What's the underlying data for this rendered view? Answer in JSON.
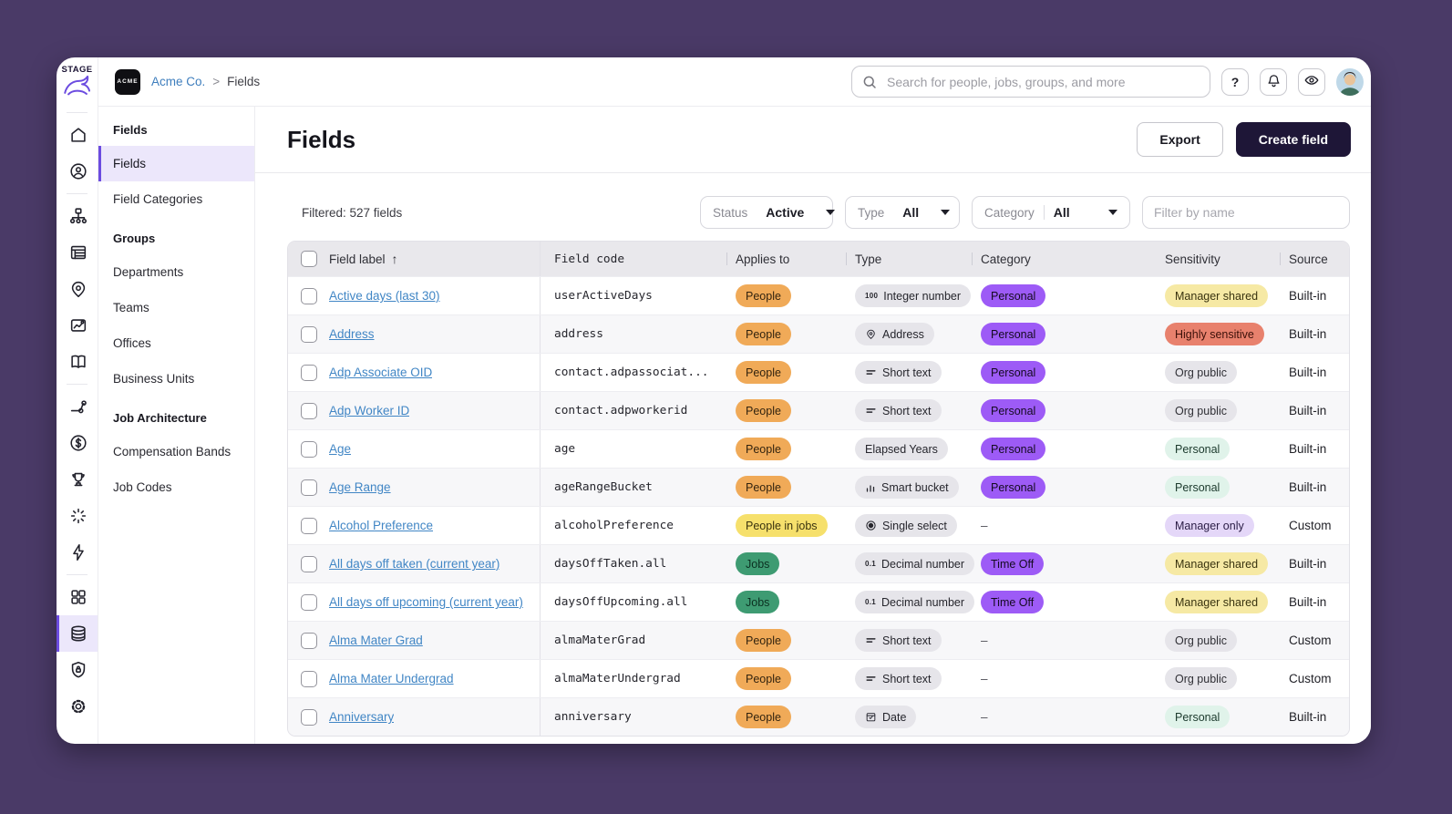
{
  "chrome": {
    "env": "STAGE"
  },
  "topbar": {
    "org_logo": "ACME",
    "breadcrumb": {
      "org": "Acme Co.",
      "separator": ">",
      "page": "Fields"
    },
    "search_placeholder": "Search for people, jobs, groups, and more",
    "help_label": "?"
  },
  "rail": {
    "items": [
      {
        "id": "home"
      },
      {
        "id": "people"
      },
      {
        "id": "org-chart"
      },
      {
        "id": "documents"
      },
      {
        "id": "locations"
      },
      {
        "id": "reports"
      },
      {
        "id": "library"
      },
      {
        "id": "workflows"
      },
      {
        "id": "payroll"
      },
      {
        "id": "performance"
      },
      {
        "id": "spark"
      },
      {
        "id": "automations"
      },
      {
        "id": "apps"
      },
      {
        "id": "data",
        "active": true
      },
      {
        "id": "security"
      },
      {
        "id": "settings"
      }
    ]
  },
  "sidenav": {
    "sections": [
      {
        "header": "Fields",
        "items": [
          {
            "label": "Fields",
            "active": true
          },
          {
            "label": "Field Categories"
          }
        ]
      },
      {
        "header": "Groups",
        "items": [
          {
            "label": "Departments"
          },
          {
            "label": "Teams"
          },
          {
            "label": "Offices"
          },
          {
            "label": "Business Units"
          }
        ]
      },
      {
        "header": "Job Architecture",
        "items": [
          {
            "label": "Compensation Bands"
          },
          {
            "label": "Job Codes"
          }
        ]
      }
    ]
  },
  "page": {
    "title": "Fields",
    "export_label": "Export",
    "create_label": "Create field",
    "filtered": "Filtered: 527 fields",
    "name_filter_placeholder": "Filter by name",
    "filters": [
      {
        "id": "status",
        "label": "Status",
        "value": "Active"
      },
      {
        "id": "type",
        "label": "Type",
        "value": "All"
      },
      {
        "id": "category",
        "label": "Category",
        "value": "All"
      }
    ]
  },
  "table": {
    "sort_indicator": "↑",
    "empty": "–",
    "columns": [
      "Field label",
      "Field code",
      "Applies to",
      "Type",
      "Category",
      "Sensitivity",
      "Source"
    ],
    "rows": [
      {
        "label": "Active days (last 30)",
        "code": "userActiveDays",
        "applies": {
          "text": "People",
          "tone": "people"
        },
        "type": {
          "icon": "integer-number-icon",
          "text": "Integer number"
        },
        "category": "Personal",
        "sensitivity": {
          "text": "Manager shared",
          "tone": "yellow"
        },
        "source": "Built-in"
      },
      {
        "label": "Address",
        "code": "address",
        "applies": {
          "text": "People",
          "tone": "people"
        },
        "type": {
          "icon": "address-icon",
          "text": "Address"
        },
        "category": "Personal",
        "sensitivity": {
          "text": "Highly sensitive",
          "tone": "red"
        },
        "source": "Built-in"
      },
      {
        "label": "Adp Associate OID",
        "code": "contact.adpassociat...",
        "applies": {
          "text": "People",
          "tone": "people"
        },
        "type": {
          "icon": "short-text-icon",
          "text": "Short text"
        },
        "category": "Personal",
        "sensitivity": {
          "text": "Org public",
          "tone": "gray"
        },
        "source": "Built-in"
      },
      {
        "label": "Adp Worker ID",
        "code": "contact.adpworkerid",
        "applies": {
          "text": "People",
          "tone": "people"
        },
        "type": {
          "icon": "short-text-icon",
          "text": "Short text"
        },
        "category": "Personal",
        "sensitivity": {
          "text": "Org public",
          "tone": "gray"
        },
        "source": "Built-in"
      },
      {
        "label": "Age",
        "code": "age",
        "applies": {
          "text": "People",
          "tone": "people"
        },
        "type": {
          "icon": null,
          "text": "Elapsed Years"
        },
        "category": "Personal",
        "sensitivity": {
          "text": "Personal",
          "tone": "mint"
        },
        "source": "Built-in"
      },
      {
        "label": "Age Range",
        "code": "ageRangeBucket",
        "applies": {
          "text": "People",
          "tone": "people"
        },
        "type": {
          "icon": "smart-bucket-icon",
          "text": "Smart bucket"
        },
        "category": "Personal",
        "sensitivity": {
          "text": "Personal",
          "tone": "mint"
        },
        "source": "Built-in"
      },
      {
        "label": "Alcohol Preference",
        "code": "alcoholPreference",
        "applies": {
          "text": "People in jobs",
          "tone": "people-in-jobs"
        },
        "type": {
          "icon": "single-select-icon",
          "text": "Single select"
        },
        "category": null,
        "sensitivity": {
          "text": "Manager only",
          "tone": "lavender"
        },
        "source": "Custom"
      },
      {
        "label": "All days off taken (current year)",
        "code": "daysOffTaken.all",
        "applies": {
          "text": "Jobs",
          "tone": "jobs"
        },
        "type": {
          "icon": "decimal-number-icon",
          "text": "Decimal number"
        },
        "category": "Time Off",
        "sensitivity": {
          "text": "Manager shared",
          "tone": "yellow"
        },
        "source": "Built-in"
      },
      {
        "label": "All days off upcoming (current year)",
        "code": "daysOffUpcoming.all",
        "applies": {
          "text": "Jobs",
          "tone": "jobs"
        },
        "type": {
          "icon": "decimal-number-icon",
          "text": "Decimal number"
        },
        "category": "Time Off",
        "sensitivity": {
          "text": "Manager shared",
          "tone": "yellow"
        },
        "source": "Built-in"
      },
      {
        "label": "Alma Mater Grad",
        "code": "almaMaterGrad",
        "applies": {
          "text": "People",
          "tone": "people"
        },
        "type": {
          "icon": "short-text-icon",
          "text": "Short text"
        },
        "category": null,
        "sensitivity": {
          "text": "Org public",
          "tone": "gray"
        },
        "source": "Custom"
      },
      {
        "label": "Alma Mater Undergrad",
        "code": "almaMaterUndergrad",
        "applies": {
          "text": "People",
          "tone": "people"
        },
        "type": {
          "icon": "short-text-icon",
          "text": "Short text"
        },
        "category": null,
        "sensitivity": {
          "text": "Org public",
          "tone": "gray"
        },
        "source": "Custom"
      },
      {
        "label": "Anniversary",
        "code": "anniversary",
        "applies": {
          "text": "People",
          "tone": "people"
        },
        "type": {
          "icon": "date-icon",
          "text": "Date"
        },
        "category": null,
        "sensitivity": {
          "text": "Personal",
          "tone": "mint"
        },
        "source": "Built-in"
      }
    ]
  },
  "colors": {
    "accent": "#6C4CE0",
    "brand_navy": "#1E1637",
    "link": "#4186C5",
    "tones": {
      "people": {
        "bg": "#F0AA58",
        "fg": "#33240F"
      },
      "people-in-jobs": {
        "bg": "#F6E06C",
        "fg": "#3A330F"
      },
      "jobs": {
        "bg": "#3E9B72",
        "fg": "#0B3021"
      },
      "category": {
        "bg": "#9D5BF6",
        "fg": "#140A20"
      },
      "type": {
        "bg": "#E6E5EA",
        "fg": "#26262D"
      },
      "yellow": {
        "bg": "#F6E9A4",
        "fg": "#39330F"
      },
      "red": {
        "bg": "#E8816D",
        "fg": "#3C1009"
      },
      "gray": {
        "bg": "#E6E5EA",
        "fg": "#2F2F35"
      },
      "mint": {
        "bg": "#E0F3EA",
        "fg": "#1C3A2D"
      },
      "lavender": {
        "bg": "#E4D7F8",
        "fg": "#2A1C45"
      }
    }
  }
}
